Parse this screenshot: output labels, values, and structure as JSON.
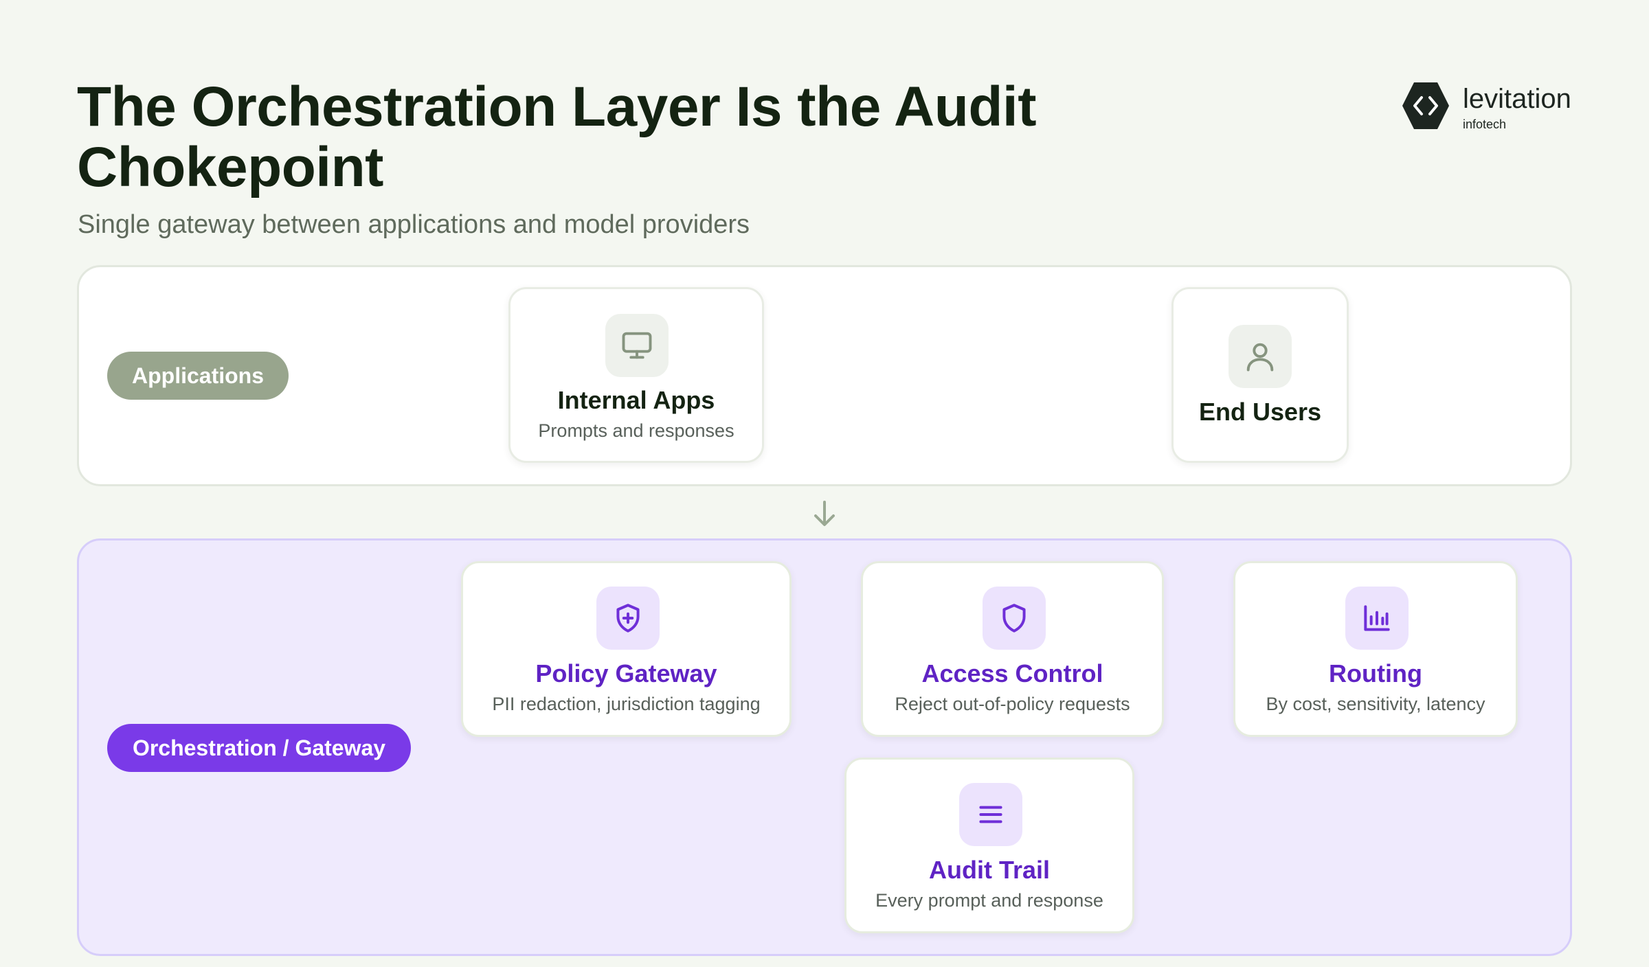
{
  "header": {
    "title": "The Orchestration Layer Is the Audit Chokepoint",
    "subtitle": "Single gateway between applications and model providers"
  },
  "logo": {
    "name": "levitation",
    "sub": "infotech",
    "icon": "hexagon-code-icon"
  },
  "applications": {
    "label": "Applications",
    "cards": [
      {
        "title": "Internal Apps",
        "desc": "Prompts and responses",
        "icon": "monitor-icon"
      },
      {
        "title": "End Users",
        "icon": "user-icon"
      }
    ]
  },
  "orchestration": {
    "label": "Orchestration / Gateway",
    "cards": [
      {
        "title": "Policy Gateway",
        "desc": "PII redaction, jurisdiction tagging",
        "icon": "shield-plus-icon"
      },
      {
        "title": "Access Control",
        "desc": "Reject out-of-policy requests",
        "icon": "shield-icon"
      },
      {
        "title": "Routing",
        "desc": "By cost, sensitivity, latency",
        "icon": "bar-chart-icon"
      },
      {
        "title": "Audit Trail",
        "desc": "Every prompt and response",
        "icon": "menu-lines-icon"
      }
    ]
  },
  "connector": {
    "icon": "arrow-down-icon"
  },
  "colors": {
    "background": "#f4f7f1",
    "title": "#142312",
    "apps_pill": "#98a58d",
    "orchestration_pill": "#7a3ae8",
    "orchestration_panel": "#efeafd",
    "purple_text": "#5f23c4"
  }
}
